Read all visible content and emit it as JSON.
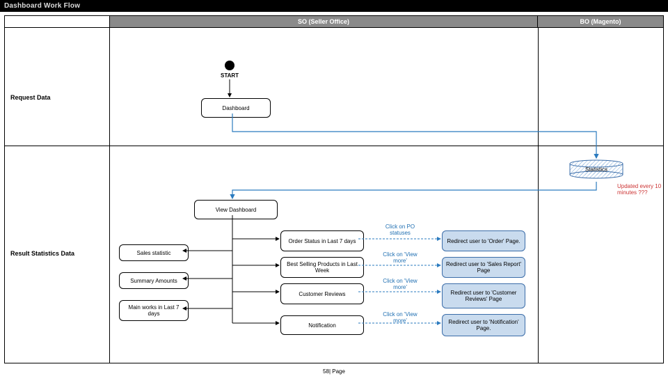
{
  "title": "Dashboard Work Flow",
  "columns": {
    "spacer": "",
    "so": "SO (Seller Office)",
    "bo": "BO (Magento)"
  },
  "lanes": {
    "request": "Request Data",
    "result": "Result Statistics Data"
  },
  "start": "START",
  "nodes": {
    "dashboard": "Dashboard",
    "viewDashboard": "View Dashboard",
    "salesStatistic": "Sales statistic",
    "summaryAmounts": "Summary Amounts",
    "mainWorks": "Main works in Last 7 days",
    "orderStatus": "Order Status in Last 7 days",
    "bestSelling": "Best Selling Products in Last Week",
    "customerReviews": "Customer Reviews",
    "notification": "Notification",
    "redirOrder": "Redirect user to 'Order' Page.",
    "redirSales": "Redirect user to 'Sales Report' Page",
    "redirReviews": "Redirect user to 'Customer Reviews' Page",
    "redirNotif": "Redirect user to 'Notification' Page.",
    "statistics": "Statistics"
  },
  "linkLabels": {
    "poStatuses": "Click on PO statuses",
    "viewMore": "Click on 'View more'"
  },
  "note": "Updated every 10 minutes ???",
  "footer": "58| Page"
}
